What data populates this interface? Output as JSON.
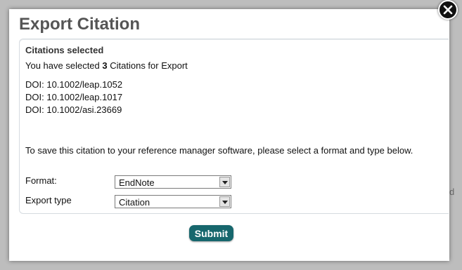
{
  "backdrop": {
    "partial_text": "d"
  },
  "dialog": {
    "title": "Export Citation",
    "close_icon": "close-icon",
    "citations": {
      "heading": "Citations selected",
      "selected_prefix": "You have selected ",
      "selected_count": "3",
      "selected_suffix": " Citations for Export",
      "dois": [
        "DOI: 10.1002/leap.1052",
        "DOI: 10.1002/leap.1017",
        "DOI: 10.1002/asi.23669"
      ]
    },
    "instructions": "To save this citation to your reference manager software, please select a format and type below.",
    "format": {
      "label": "Format:",
      "value": "EndNote"
    },
    "export_type": {
      "label": "Export type",
      "value": "Citation"
    },
    "submit_label": "Submit"
  },
  "colors": {
    "submit_bg": "#17676d",
    "title": "#555555",
    "panel_border": "#d6dbe0"
  }
}
